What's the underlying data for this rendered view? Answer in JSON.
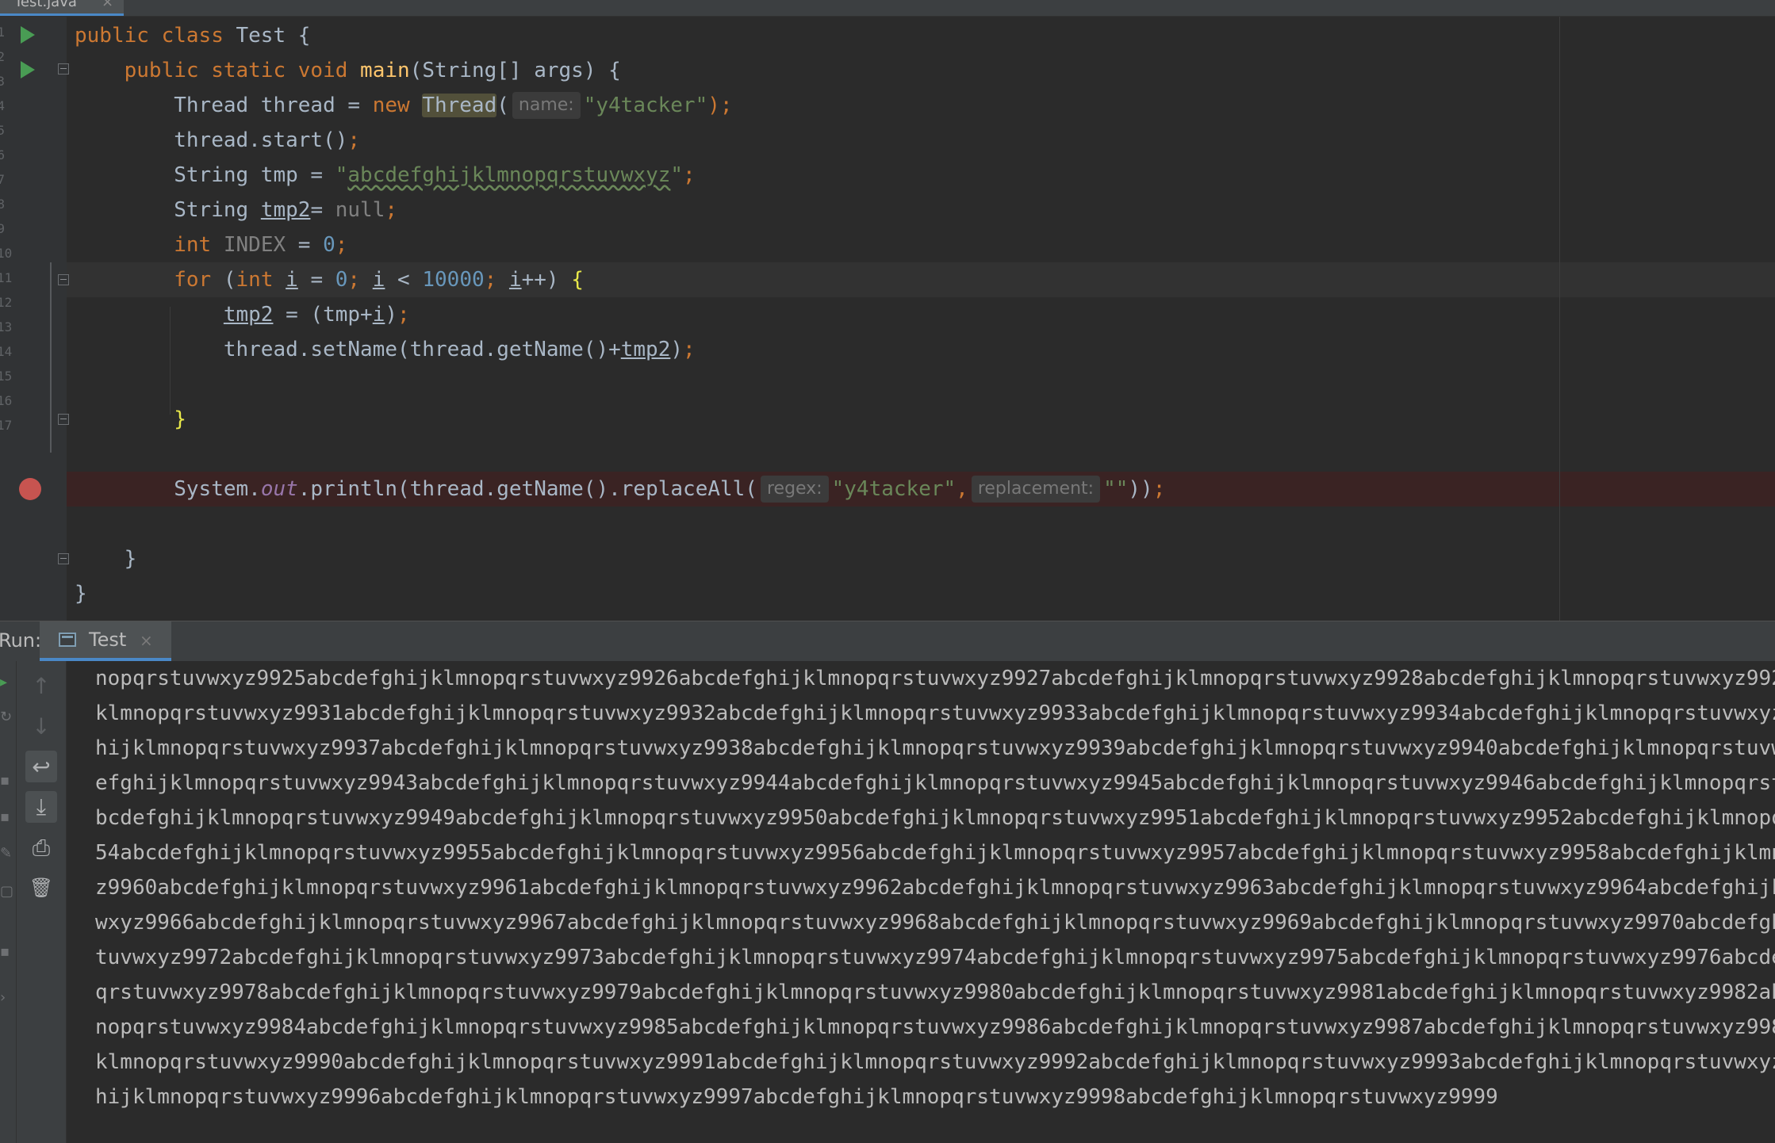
{
  "file_tab": {
    "label": "Test.java",
    "close": "×"
  },
  "editor": {
    "line_numbers": [
      "1",
      "2",
      "3",
      "4",
      "5",
      "6",
      "7",
      "8",
      "9",
      "10",
      "11",
      "12",
      "13",
      "14",
      "15",
      "16",
      "17"
    ]
  },
  "code": {
    "l1": {
      "kw_public": "public ",
      "kw_class": "class ",
      "rest": "Test {"
    },
    "l2": {
      "indent": "    ",
      "kw": "public static void ",
      "fn": "main",
      "rest": "(String[] args) {"
    },
    "l3": {
      "indent": "        ",
      "t1": "Thread thread = ",
      "kw_new": "new ",
      "ctor": "Thread",
      "paren": "(",
      "hint_name": "name:",
      "str": "\"y4tacker\"",
      "end": ");"
    },
    "l4": {
      "indent": "        ",
      "t1": "thread.start()",
      "semi": ";"
    },
    "l5": {
      "indent": "        ",
      "t1": "String tmp = ",
      "q1": "\"",
      "str_inner": "abcdefghijklmnopqrstuvwxyz",
      "q2": "\"",
      "semi": ";"
    },
    "l6": {
      "indent": "        ",
      "t1": "String ",
      "var": "tmp2",
      "t2": "= ",
      "null": "null",
      "semi": ";"
    },
    "l7": {
      "indent": "        ",
      "kw": "int ",
      "const": "INDEX",
      "t1": " = ",
      "num": "0",
      "semi": ";"
    },
    "l8": {
      "indent": "        ",
      "kw_for": "for ",
      "p1": "(",
      "kw_int": "int ",
      "i1": "i",
      "t1": " = ",
      "n0": "0",
      "s1": "; ",
      "i2": "i",
      "t2": " < ",
      "n10000": "10000",
      "s2": "; ",
      "i3": "i",
      "t3": "++) ",
      "brace": "{"
    },
    "l9": {
      "indent": "            ",
      "var1": "tmp2",
      "t1": " = (tmp+",
      "var2": "i",
      "t2": ")",
      "semi": ";"
    },
    "l10": {
      "indent": "            ",
      "t1": "thread.setName(thread.getName()+",
      "var": "tmp2",
      "t2": ")",
      "semi": ";"
    },
    "l12": {
      "indent": "        ",
      "brace": "}"
    },
    "l14": {
      "indent": "        ",
      "t1": "System.",
      "field": "out",
      "t2": ".println(thread.getName().replaceAll(",
      "hint_regex": "regex:",
      "str1": "\"y4tacker\"",
      "comma": ",",
      "hint_replacement": "replacement:",
      "str2": "\"\"",
      "t3": "))",
      "semi": ";"
    },
    "l16": {
      "indent": "    ",
      "t1": "}"
    },
    "l17": {
      "t1": "}"
    }
  },
  "run_panel": {
    "label": "Run:",
    "tab_label": "Test",
    "tab_close": "×",
    "toolbar": {
      "up": "↑",
      "down": "↓",
      "soft_wrap": "↩",
      "scroll_end": "⤓",
      "print": "⎙",
      "clear": "🗑"
    },
    "console_lines": [
      "nopqrstuvwxyz9925abcdefghijklmnopqrstuvwxyz9926abcdefghijklmnopqrstuvwxyz9927abcdefghijklmnopqrstuvwxyz9928abcdefghijklmnopqrstuvwxyz992",
      "klmnopqrstuvwxyz9931abcdefghijklmnopqrstuvwxyz9932abcdefghijklmnopqrstuvwxyz9933abcdefghijklmnopqrstuvwxyz9934abcdefghijklmnopqrstuvwxyz",
      "hijklmnopqrstuvwxyz9937abcdefghijklmnopqrstuvwxyz9938abcdefghijklmnopqrstuvwxyz9939abcdefghijklmnopqrstuvwxyz9940abcdefghijklmnopqrstuvw",
      "efghijklmnopqrstuvwxyz9943abcdefghijklmnopqrstuvwxyz9944abcdefghijklmnopqrstuvwxyz9945abcdefghijklmnopqrstuvwxyz9946abcdefghijklmnopqrst",
      "bcdefghijklmnopqrstuvwxyz9949abcdefghijklmnopqrstuvwxyz9950abcdefghijklmnopqrstuvwxyz9951abcdefghijklmnopqrstuvwxyz9952abcdefghijklmnopq",
      "54abcdefghijklmnopqrstuvwxyz9955abcdefghijklmnopqrstuvwxyz9956abcdefghijklmnopqrstuvwxyz9957abcdefghijklmnopqrstuvwxyz9958abcdefghijklmn",
      "z9960abcdefghijklmnopqrstuvwxyz9961abcdefghijklmnopqrstuvwxyz9962abcdefghijklmnopqrstuvwxyz9963abcdefghijklmnopqrstuvwxyz9964abcdefghijk",
      "wxyz9966abcdefghijklmnopqrstuvwxyz9967abcdefghijklmnopqrstuvwxyz9968abcdefghijklmnopqrstuvwxyz9969abcdefghijklmnopqrstuvwxyz9970abcdefgh",
      "tuvwxyz9972abcdefghijklmnopqrstuvwxyz9973abcdefghijklmnopqrstuvwxyz9974abcdefghijklmnopqrstuvwxyz9975abcdefghijklmnopqrstuvwxyz9976abcde",
      "qrstuvwxyz9978abcdefghijklmnopqrstuvwxyz9979abcdefghijklmnopqrstuvwxyz9980abcdefghijklmnopqrstuvwxyz9981abcdefghijklmnopqrstuvwxyz9982ab",
      "nopqrstuvwxyz9984abcdefghijklmnopqrstuvwxyz9985abcdefghijklmnopqrstuvwxyz9986abcdefghijklmnopqrstuvwxyz9987abcdefghijklmnopqrstuvwxyz998",
      "klmnopqrstuvwxyz9990abcdefghijklmnopqrstuvwxyz9991abcdefghijklmnopqrstuvwxyz9992abcdefghijklmnopqrstuvwxyz9993abcdefghijklmnopqrstuvwxyz",
      "hijklmnopqrstuvwxyz9996abcdefghijklmnopqrstuvwxyz9997abcdefghijklmnopqrstuvwxyz9998abcdefghijklmnopqrstuvwxyz9999"
    ]
  },
  "colors": {
    "background": "#2b2b2b",
    "keyword": "#cc7832",
    "method": "#ffc66d",
    "string": "#6a8759",
    "number": "#6897bb",
    "breakpoint": "#c75450",
    "run_arrow": "#499c54",
    "accent": "#4a88c7"
  }
}
